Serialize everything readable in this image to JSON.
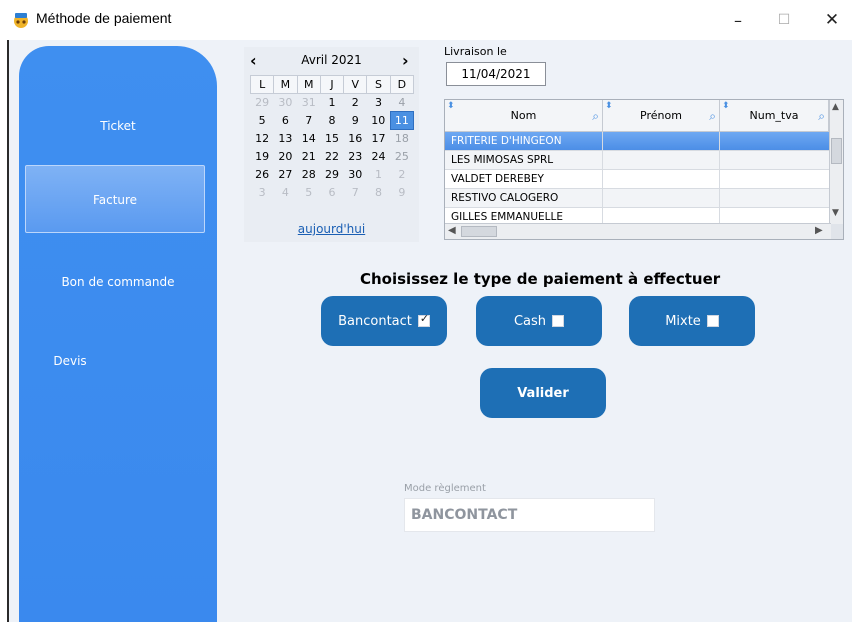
{
  "window": {
    "title": "Méthode de paiement",
    "minimize": "–",
    "maximize": "☐",
    "close": "✕"
  },
  "sidebar": {
    "items": [
      {
        "label": "Ticket"
      },
      {
        "label": "Facture",
        "selected": true
      },
      {
        "label": "Bon de commande"
      },
      {
        "label": "Devis"
      }
    ],
    "color": "#3f8ff0"
  },
  "calendar": {
    "month": "Avril 2021",
    "prev": "‹",
    "next": "›",
    "weekdays": [
      "L",
      "M",
      "M",
      "J",
      "V",
      "S",
      "D"
    ],
    "weeks": [
      [
        [
          "29",
          "o"
        ],
        [
          "30",
          "o"
        ],
        [
          "31",
          "o"
        ],
        [
          "1",
          ""
        ],
        [
          "2",
          ""
        ],
        [
          "3",
          ""
        ],
        [
          "4",
          "w"
        ]
      ],
      [
        [
          "5",
          ""
        ],
        [
          "6",
          ""
        ],
        [
          "7",
          ""
        ],
        [
          "8",
          ""
        ],
        [
          "9",
          ""
        ],
        [
          "10",
          ""
        ],
        [
          "11",
          "t"
        ]
      ],
      [
        [
          "12",
          ""
        ],
        [
          "13",
          ""
        ],
        [
          "14",
          ""
        ],
        [
          "15",
          ""
        ],
        [
          "16",
          ""
        ],
        [
          "17",
          ""
        ],
        [
          "18",
          "w"
        ]
      ],
      [
        [
          "19",
          ""
        ],
        [
          "20",
          ""
        ],
        [
          "21",
          ""
        ],
        [
          "22",
          ""
        ],
        [
          "23",
          ""
        ],
        [
          "24",
          ""
        ],
        [
          "25",
          "w"
        ]
      ],
      [
        [
          "26",
          ""
        ],
        [
          "27",
          ""
        ],
        [
          "28",
          ""
        ],
        [
          "29",
          ""
        ],
        [
          "30",
          ""
        ],
        [
          "1",
          "o"
        ],
        [
          "2",
          "o"
        ]
      ],
      [
        [
          "3",
          "o"
        ],
        [
          "4",
          "o"
        ],
        [
          "5",
          "o"
        ],
        [
          "6",
          "o"
        ],
        [
          "7",
          "o"
        ],
        [
          "8",
          "o"
        ],
        [
          "9",
          "o"
        ]
      ]
    ],
    "today_link": "aujourd'hui"
  },
  "livraison": {
    "label": "Livraison le",
    "value": "11/04/2021"
  },
  "table": {
    "columns": [
      "Nom",
      "Prénom",
      "Num_tva"
    ],
    "rows": [
      {
        "nom": "FRITERIE D'HINGEON",
        "prenom": "",
        "num_tva": "",
        "selected": true
      },
      {
        "nom": "LES MIMOSAS SPRL",
        "prenom": "",
        "num_tva": ""
      },
      {
        "nom": "VALDET DEREBEY",
        "prenom": "",
        "num_tva": ""
      },
      {
        "nom": "RESTIVO CALOGERO",
        "prenom": "",
        "num_tva": ""
      },
      {
        "nom": "GILLES EMMANUELLE",
        "prenom": "",
        "num_tva": ""
      }
    ]
  },
  "payment": {
    "title": "Choisissez le type de paiement à effectuer",
    "options": [
      {
        "label": "Bancontact",
        "checked": true
      },
      {
        "label": "Cash",
        "checked": false
      },
      {
        "label": "Mixte",
        "checked": false
      }
    ],
    "validate": "Valider",
    "button_color": "#1e6fb5"
  },
  "mode_reglement": {
    "label": "Mode règlement",
    "value": "BANCONTACT"
  }
}
